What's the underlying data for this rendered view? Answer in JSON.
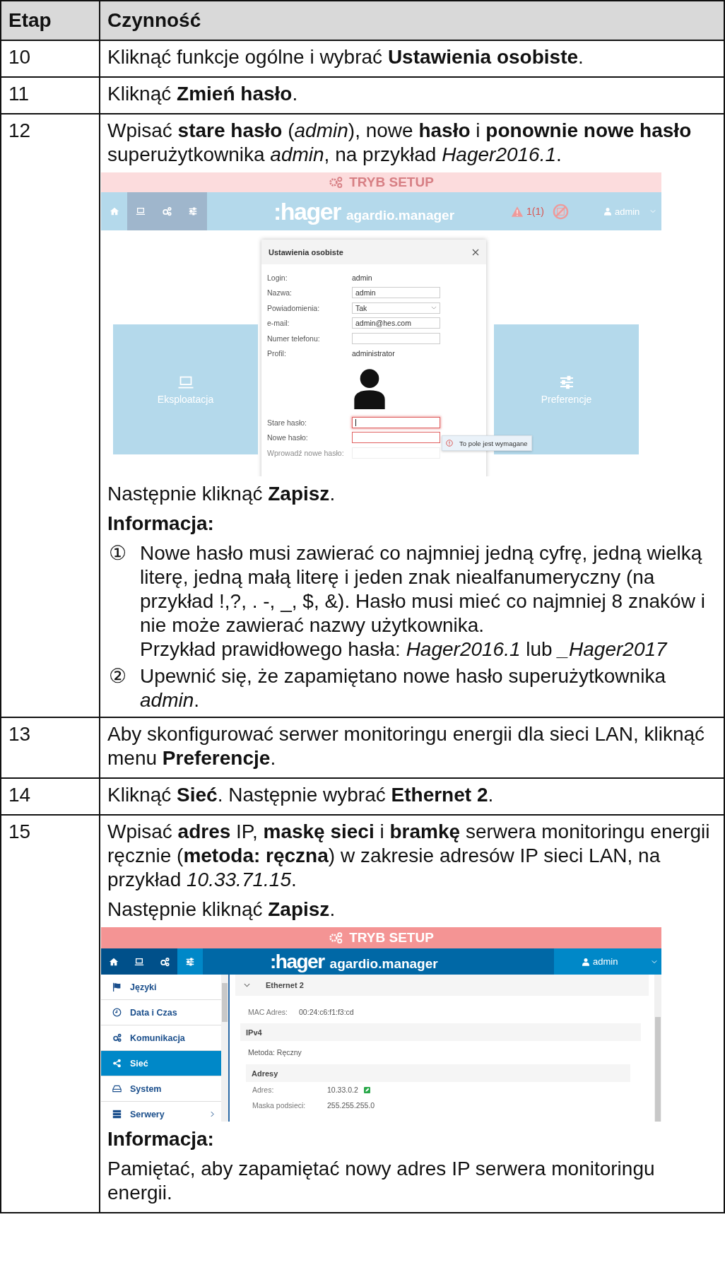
{
  "table": {
    "columns": [
      "Etap",
      "Czynność"
    ],
    "rows": [
      {
        "step": "10",
        "blocks": [
          {
            "kind": "text",
            "text": "Kliknąć funkcje ogólne i wybrać **Ustawienia osobiste**."
          }
        ]
      },
      {
        "step": "11",
        "blocks": [
          {
            "kind": "text",
            "text": "Kliknąć **Zmień hasło**."
          }
        ]
      },
      {
        "step": "12",
        "blocks": [
          {
            "kind": "text",
            "text": "Wpisać **stare hasło** (*admin*), nowe **hasło** i **ponownie nowe hasło** superużytkownika *admin*, na przykład *Hager2016.1*."
          },
          {
            "kind": "settings_screen",
            "banner": "TRYB SETUP",
            "logo": ":hager",
            "product": "agardio.manager",
            "alarm": "1(1)",
            "user": "admin",
            "nav": [
              {
                "selected": true
              },
              {
                "selected": false
              },
              {
                "selected": false
              },
              {
                "selected": false
              }
            ],
            "tiles": [
              {
                "label": "Eksploatacja"
              },
              {
                "label": "Preferencje"
              }
            ],
            "dialog": {
              "title": "Ustawienia osobiste",
              "fields": [
                {
                  "kind": "static",
                  "label": "Login:",
                  "value": "admin"
                },
                {
                  "kind": "input",
                  "label": "Nazwa:",
                  "value": "admin",
                  "invalid": false,
                  "faded": false,
                  "focused": false
                },
                {
                  "kind": "select",
                  "label": "Powiadomienia:",
                  "value": "Tak"
                },
                {
                  "kind": "input",
                  "label": "e-mail:",
                  "value": "admin@hes.com",
                  "invalid": false,
                  "faded": false,
                  "focused": false
                },
                {
                  "kind": "input",
                  "label": "Numer telefonu:",
                  "invalid": false,
                  "faded": false,
                  "focused": false
                },
                {
                  "kind": "static",
                  "label": "Profil:",
                  "value": "administrator"
                },
                {
                  "kind": "avatar"
                },
                {
                  "kind": "input",
                  "label": "Stare hasło:",
                  "invalid": true,
                  "faded": false,
                  "focused": true
                },
                {
                  "kind": "input",
                  "label": "Nowe hasło:",
                  "invalid": true,
                  "faded": false,
                  "focused": false
                },
                {
                  "kind": "input",
                  "label": "Wprowadź nowe hasło:",
                  "invalid": false,
                  "faded": true,
                  "focused": false
                }
              ]
            },
            "tooltip": "To pole jest wymagane"
          },
          {
            "kind": "text",
            "text": "Następnie kliknąć **Zapisz**."
          },
          {
            "kind": "heading",
            "text": "Informacja:"
          },
          {
            "kind": "list",
            "items": [
              {
                "marker": "①",
                "lines": [
                  "Nowe hasło musi zawierać co najmniej jedną cyfrę, jedną wielką literę, jedną małą literę i jeden znak niealfanumeryczny (na przykład !,?, . -, _, $, &). Hasło musi mieć co najmniej 8 znaków i nie może zawierać nazwy użytkownika.",
                  "Przykład prawidłowego hasła: *Hager2016.1* lub *_Hager2017*"
                ]
              },
              {
                "marker": "②",
                "lines": [
                  "Upewnić się, że zapamiętano nowe hasło superużytkownika *admin*."
                ]
              }
            ]
          }
        ]
      },
      {
        "step": "13",
        "blocks": [
          {
            "kind": "text",
            "text": "Aby skonfigurować serwer monitoringu energii dla sieci LAN, kliknąć menu **Preferencje**."
          }
        ]
      },
      {
        "step": "14",
        "blocks": [
          {
            "kind": "text",
            "text": "Kliknąć **Sieć**. Następnie wybrać **Ethernet 2**."
          }
        ]
      },
      {
        "step": "15",
        "blocks": [
          {
            "kind": "text",
            "text": "Wpisać **adres** IP, **maskę sieci** i **bramkę** serwera monitoringu energii ręcznie (**metoda: ręczna**) w zakresie adresów IP sieci LAN, na przykład *10.33.71.15*."
          },
          {
            "kind": "text",
            "text": "Następnie kliknąć **Zapisz**."
          },
          {
            "kind": "network_screen",
            "banner": "TRYB SETUP",
            "logo": ":hager",
            "product": "agardio.manager",
            "user": "admin",
            "nav": [
              {
                "selected": false
              },
              {
                "selected": false
              },
              {
                "selected": false
              },
              {
                "selected": true
              }
            ],
            "menu": [
              {
                "label": "Języki",
                "selected": false,
                "submenu": false
              },
              {
                "label": "Data i Czas",
                "selected": false,
                "submenu": false
              },
              {
                "label": "Komunikacja",
                "selected": false,
                "submenu": false
              },
              {
                "label": "Sieć",
                "selected": true,
                "submenu": false
              },
              {
                "label": "System",
                "selected": false,
                "submenu": false
              },
              {
                "label": "Serwery",
                "selected": false,
                "submenu": true
              }
            ],
            "section": "Ethernet 2",
            "mac_label": "MAC Adres:",
            "mac": "00:24:c6:f1:f3:cd",
            "ipv4": "IPv4",
            "method": "Metoda: Ręczny",
            "addresses": "Adresy",
            "address_label": "Adres:",
            "address": "10.33.0.2",
            "mask_label": "Maska podsieci:",
            "mask": "255.255.255.0"
          },
          {
            "kind": "heading",
            "text": "Informacja:"
          },
          {
            "kind": "text",
            "text": "Pamiętać, aby zapamiętać nowy adres IP serwera monitoringu energii."
          }
        ]
      }
    ]
  }
}
